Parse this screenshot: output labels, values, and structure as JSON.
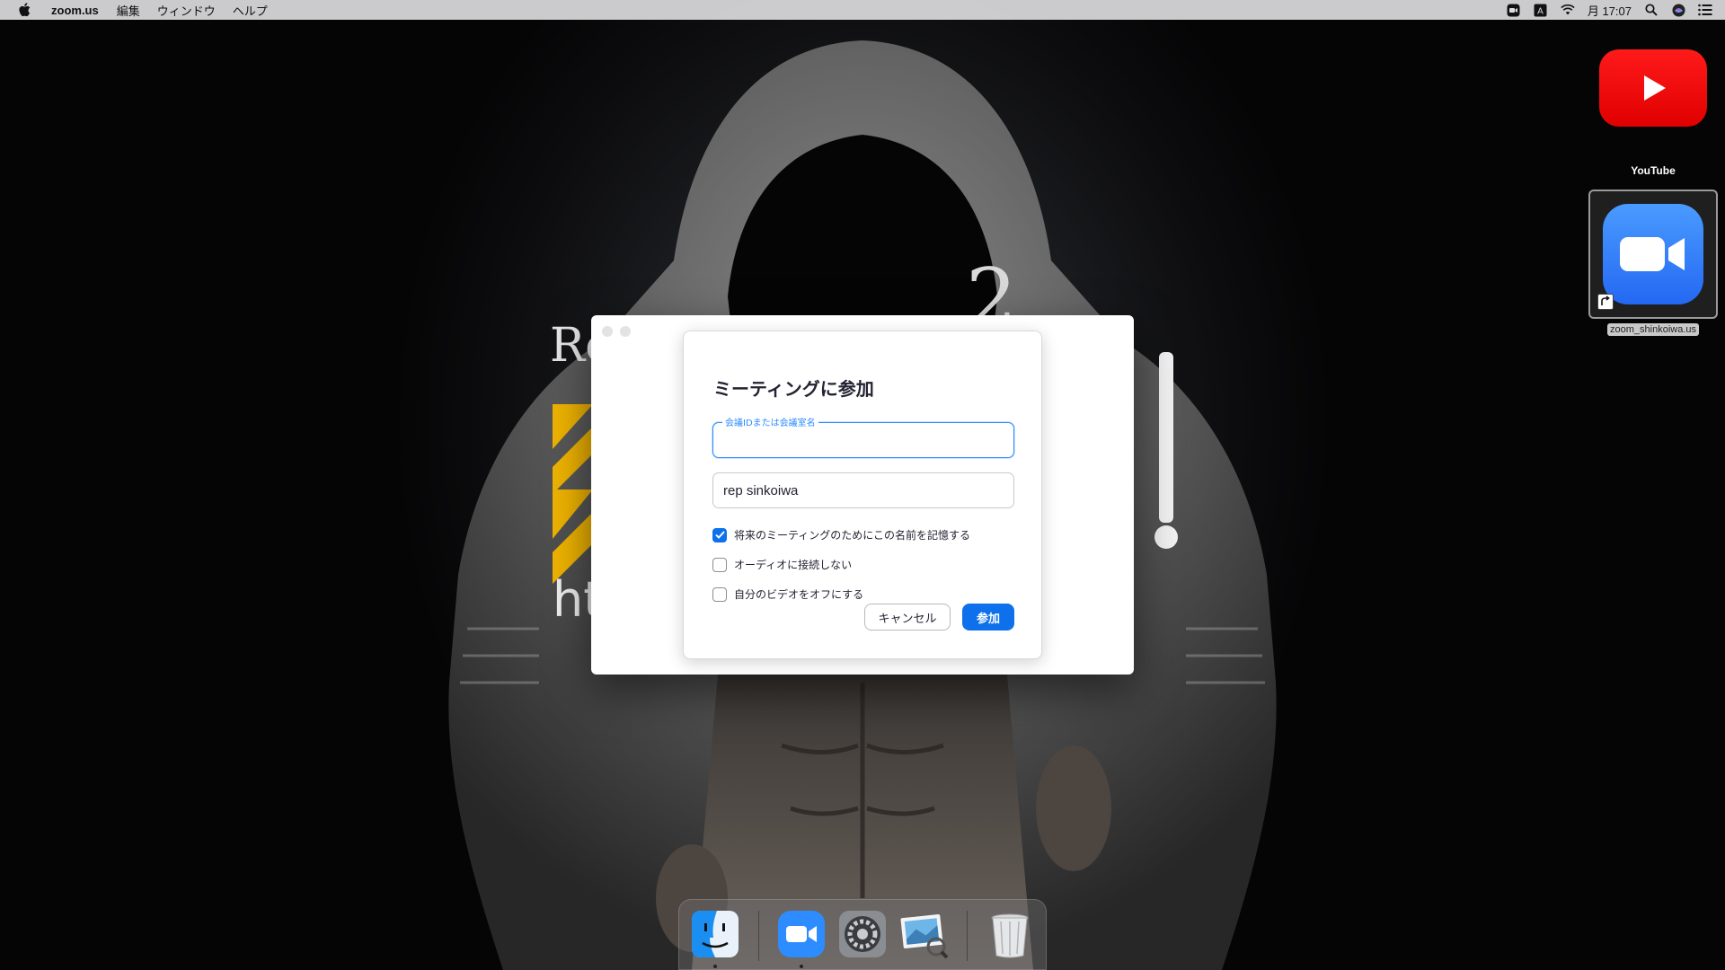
{
  "menubar": {
    "app_name": "zoom.us",
    "menus": [
      "編集",
      "ウィンドウ",
      "ヘルプ"
    ],
    "clock": "月 17:07",
    "status_icons": [
      "zoom-status-icon",
      "input-source-icon",
      "wifi-icon",
      "spotlight-search-icon",
      "siri-icon",
      "notification-center-icon"
    ]
  },
  "desktop": {
    "icons": [
      {
        "name": "youtube",
        "label": "YouTube",
        "color": "#ff0000"
      },
      {
        "name": "zoom-alias",
        "label": "zoom_shinkoiwa.us",
        "color": "#2d8cff",
        "selected": true
      }
    ]
  },
  "dialog": {
    "title": "ミーティングに参加",
    "meeting_id_label": "会議IDまたは会議室名",
    "meeting_id_value": "",
    "name_value": "rep sinkoiwa",
    "options": [
      {
        "label": "将来のミーティングのためにこの名前を記憶する",
        "checked": true
      },
      {
        "label": "オーディオに接続しない",
        "checked": false
      },
      {
        "label": "自分のビデオをオフにする",
        "checked": false
      }
    ],
    "cancel_label": "キャンセル",
    "join_label": "参加",
    "accent_color": "#0e71eb"
  },
  "wallpaper": {
    "fragments": [
      "Re",
      "ht",
      "2",
      "!"
    ]
  },
  "dock": {
    "items": [
      {
        "name": "finder",
        "running": true
      },
      {
        "name": "zoom",
        "running": true
      },
      {
        "name": "system-preferences",
        "running": false
      },
      {
        "name": "preview",
        "running": false
      },
      {
        "name": "trash",
        "running": false
      }
    ]
  }
}
